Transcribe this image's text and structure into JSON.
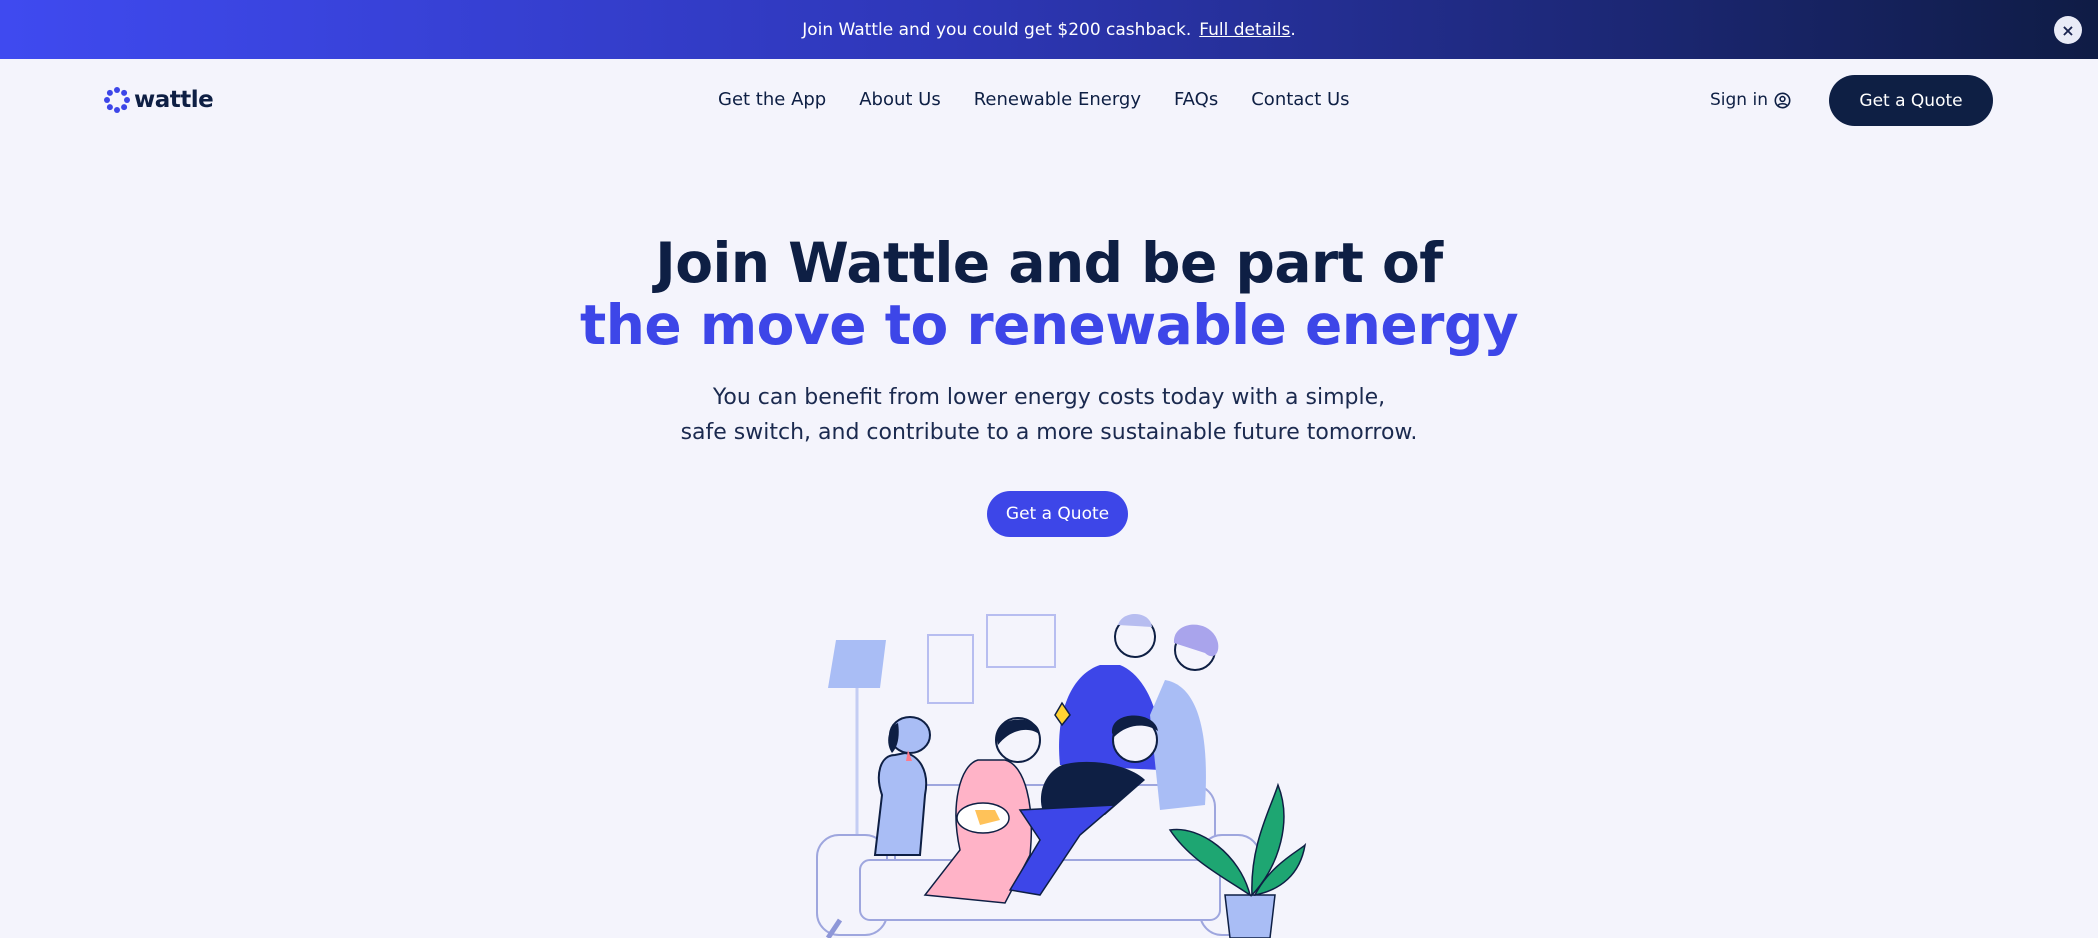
{
  "promo": {
    "message": "Join Wattle and you could get $200 cashback.",
    "link_label": "Full details",
    "trailing": ".",
    "close_label": "×"
  },
  "nav": {
    "logo_text": "wattle",
    "links": [
      "Get the App",
      "About Us",
      "Renewable Energy",
      "FAQs",
      "Contact Us"
    ],
    "sign_in": "Sign in",
    "cta": "Get a Quote"
  },
  "hero": {
    "title_line1": "Join Wattle and be part of",
    "title_line2": "the move to renewable energy",
    "sub_line1": "You can benefit from lower energy costs today with a simple,",
    "sub_line2": "safe switch, and contribute to a more sustainable future tomorrow.",
    "cta": "Get a Quote"
  },
  "colors": {
    "brand_navy": "#0e1f44",
    "brand_blue": "#3d46e8",
    "background": "#f4f4fc"
  },
  "icons": {
    "logo": "wattle-burst-icon",
    "sign_in": "user-circle-icon",
    "close": "close-icon"
  }
}
